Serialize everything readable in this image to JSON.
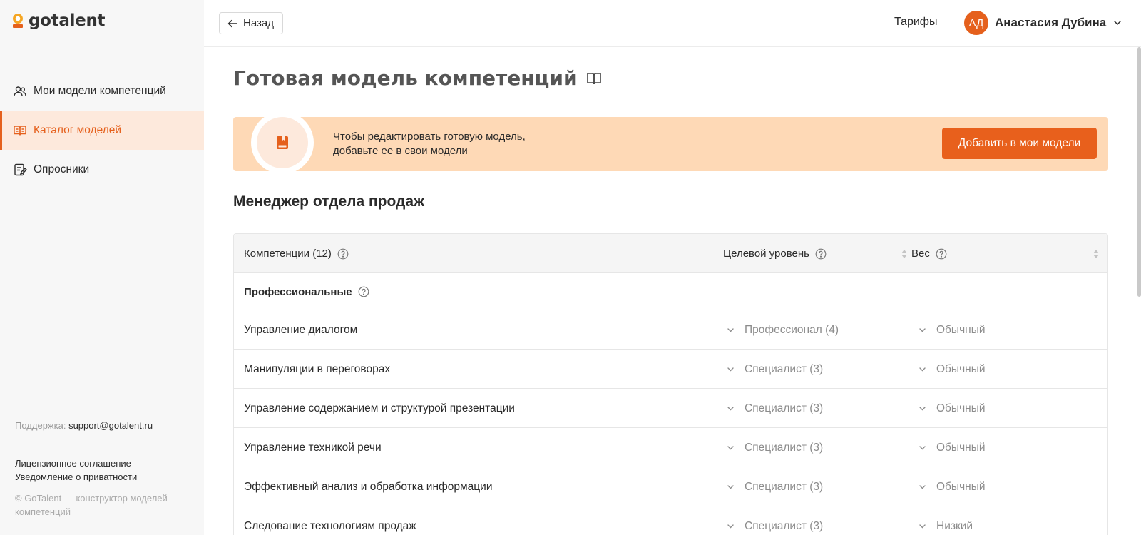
{
  "brand": {
    "name": "gotalent",
    "accent": "#e5601c"
  },
  "sidebar": {
    "items": [
      {
        "label": "Мои модели компетенций",
        "icon": "users-icon",
        "active": false
      },
      {
        "label": "Каталог моделей",
        "icon": "open-book-icon",
        "active": true
      },
      {
        "label": "Опросники",
        "icon": "questionnaire-icon",
        "active": false
      }
    ],
    "support_label": "Поддержка:",
    "support_email": "support@gotalent.ru",
    "license_link": "Лицензионное соглашение",
    "privacy_link": "Уведомление о приватности",
    "copyright": "© GoTalent — конструктор моделей компетенций"
  },
  "header": {
    "back_label": "Назад",
    "tariffs_label": "Тарифы",
    "user_initials": "АД",
    "user_name": "Анастасия Дубина"
  },
  "page": {
    "title": "Готовая модель компетенций",
    "banner_line1": "Чтобы редактировать готовую модель,",
    "banner_line2": "добавьте ее в свои модели",
    "add_button": "Добавить в мои модели",
    "model_name": "Менеджер отдела продаж"
  },
  "table": {
    "col_competencies": "Компетенции (12)",
    "col_target_level": "Целевой уровень",
    "col_weight": "Вес",
    "group_label": "Профессиональные",
    "rows": [
      {
        "name": "Управление диалогом",
        "level": "Профессионал (4)",
        "weight": "Обычный"
      },
      {
        "name": "Манипуляции в переговорах",
        "level": "Специалист (3)",
        "weight": "Обычный"
      },
      {
        "name": "Управление содержанием и структурой презентации",
        "level": "Специалист (3)",
        "weight": "Обычный"
      },
      {
        "name": "Управление техникой речи",
        "level": "Специалист (3)",
        "weight": "Обычный"
      },
      {
        "name": "Эффективный анализ и обработка информации",
        "level": "Специалист (3)",
        "weight": "Обычный"
      },
      {
        "name": "Следование технологиям продаж",
        "level": "Специалист (3)",
        "weight": "Низкий"
      }
    ]
  }
}
